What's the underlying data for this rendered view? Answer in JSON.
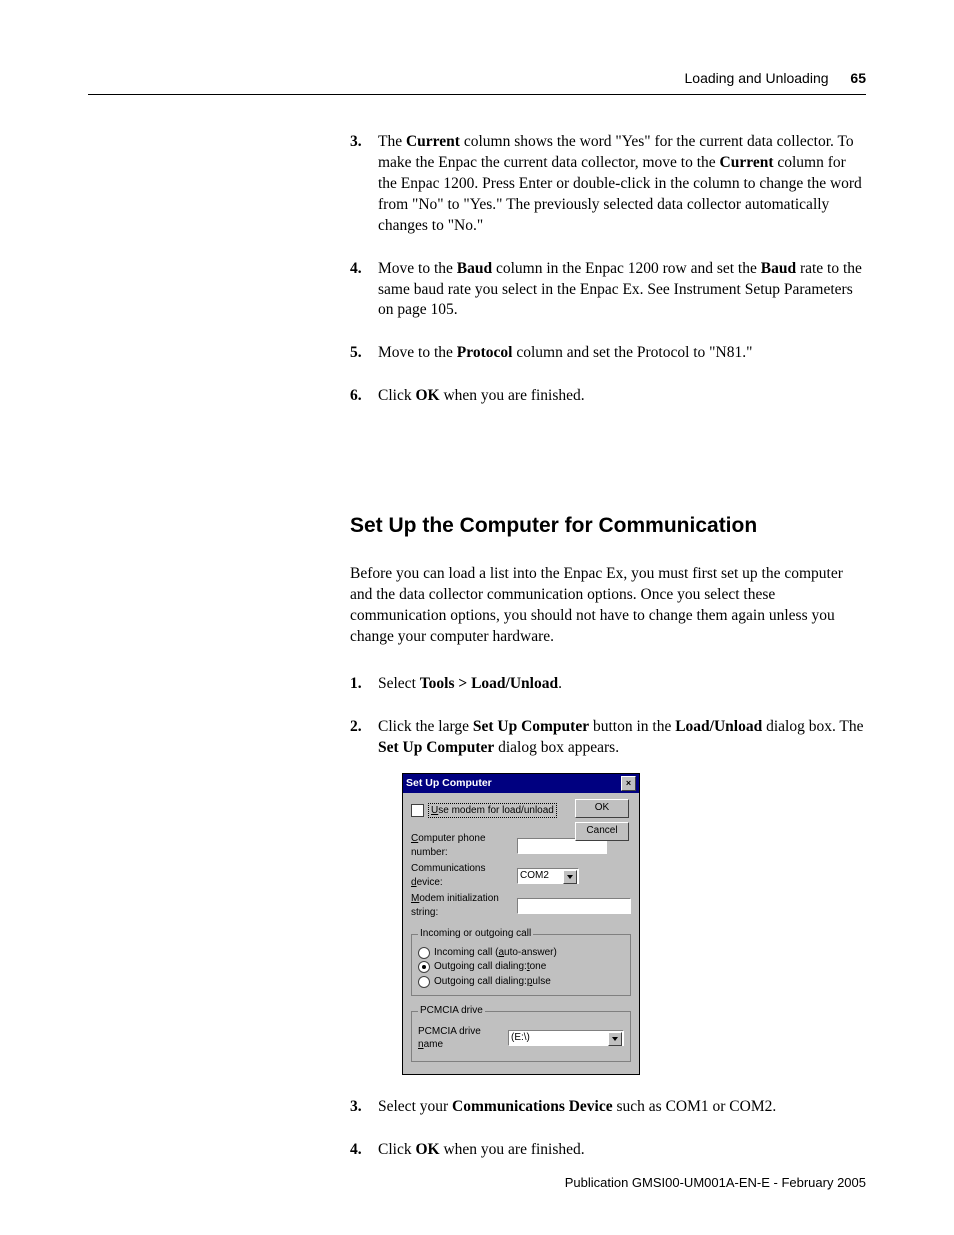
{
  "header": {
    "section": "Loading and Unloading",
    "page": "65"
  },
  "step3": {
    "num": "3.",
    "t1": "The ",
    "b1": "Current",
    "t2": " column shows the word \"Yes\" for the current data collector. To make the Enpac the current data collector, move to the ",
    "b2": "Current",
    "t3": " column for the Enpac 1200. Press Enter or double-click in the column to change the word from \"No\" to \"Yes.\" The previously selected data collector automatically changes to \"No.\""
  },
  "step4": {
    "num": "4.",
    "t1": "Move to the ",
    "b1": "Baud",
    "t2": " column in the Enpac 1200 row and set the ",
    "b2": "Baud",
    "t3": " rate to the same baud rate you select in the Enpac Ex. See Instrument Setup Parameters on page 105."
  },
  "step5": {
    "num": "5.",
    "t1": "Move to the ",
    "b1": "Protocol",
    "t2": " column and set the Protocol to \"N81.\""
  },
  "step6": {
    "num": "6.",
    "t1": "Click ",
    "b1": "OK",
    "t2": " when you are finished."
  },
  "heading": "Set Up the Computer for Communication",
  "intro": "Before you can load a list into the Enpac Ex, you must first set up the computer and the data collector communication options. Once you select these communication options, you should not have to change them again unless you change your computer hardware.",
  "s2_1": {
    "num": "1.",
    "t1": "Select ",
    "b1": "Tools > Load/Unload",
    "t2": "."
  },
  "s2_2": {
    "num": "2.",
    "t1": "Click the large ",
    "b1": "Set Up Computer",
    "t2": " button in the ",
    "b2": "Load/Unload",
    "t3": " dialog box. The ",
    "b3": "Set Up Computer",
    "t4": " dialog box appears."
  },
  "dialog": {
    "title": "Set Up Computer",
    "ok": "OK",
    "cancel": "Cancel",
    "chk_pre": "U",
    "chk_label": "se modem for load/unload",
    "phone_pre": "C",
    "phone_label": "omputer phone number:",
    "dev_label": "Communications ",
    "dev_ul": "d",
    "dev_after": "evice:",
    "dev_value": "COM2",
    "mis_ul": "M",
    "mis_label": "odem initialization string:",
    "grp1": "Incoming or outgoing call",
    "r1_pre": "Incoming call (",
    "r1_ul": "a",
    "r1_post": "uto-answer)",
    "r2_pre": "Outgoing call dialing: ",
    "r2_ul": "t",
    "r2_post": "one",
    "r3_pre": "Outgoing call dialing: ",
    "r3_ul": "p",
    "r3_post": "ulse",
    "grp2": "PCMCIA drive",
    "pc_pre": "PCMCIA drive ",
    "pc_ul": "n",
    "pc_post": "ame",
    "pc_value": "(E:\\)"
  },
  "s2_3": {
    "num": "3.",
    "t1": "Select your ",
    "b1": "Communications Device",
    "t2": " such as COM1 or COM2."
  },
  "s2_4": {
    "num": "4.",
    "t1": "Click ",
    "b1": "OK",
    "t2": " when you are finished."
  },
  "footer": "Publication GMSI00-UM001A-EN-E - February 2005"
}
